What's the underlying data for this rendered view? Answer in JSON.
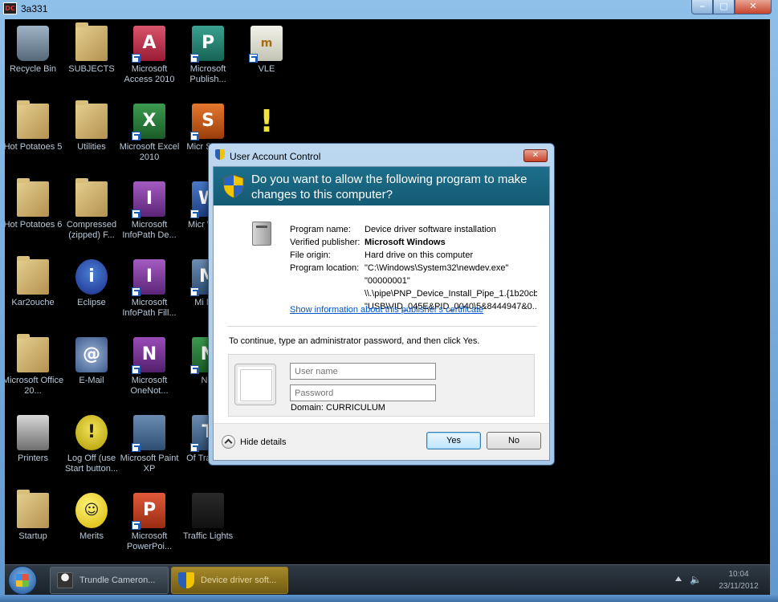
{
  "window": {
    "title": "3a331",
    "app_badge": "DC",
    "controls": [
      "–",
      "▢",
      "✕"
    ]
  },
  "desktop_icons": [
    {
      "label": "Recycle Bin",
      "glyph": "bin"
    },
    {
      "label": "SUBJECTS",
      "glyph": "folder"
    },
    {
      "label": "Microsoft Access 2010",
      "glyph": "A"
    },
    {
      "label": "Microsoft Publish...",
      "glyph": "P"
    },
    {
      "label": "VLE",
      "glyph": "m"
    },
    {
      "label": "Hot Potatoes 5",
      "glyph": "folder"
    },
    {
      "label": "Utilities",
      "glyph": "folder"
    },
    {
      "label": "Microsoft Excel 2010",
      "glyph": "X"
    },
    {
      "label": "Micr Share",
      "glyph": "S"
    },
    {
      "label": "Hot Potatoes 6",
      "glyph": "folder"
    },
    {
      "label": "Compressed (zipped) F...",
      "glyph": "folder"
    },
    {
      "label": "Microsoft InfoPath De...",
      "glyph": "I"
    },
    {
      "label": "Micr Word",
      "glyph": "W"
    },
    {
      "label": "Kar2ouche",
      "glyph": "folder"
    },
    {
      "label": "Eclipse",
      "glyph": "i"
    },
    {
      "label": "Microsoft InfoPath Fill...",
      "glyph": "I"
    },
    {
      "label": "Mi Mar",
      "glyph": "M"
    },
    {
      "label": "Microsoft Office 20...",
      "glyph": "folder"
    },
    {
      "label": "E-Mail",
      "glyph": "@"
    },
    {
      "label": "Microsoft OneNot...",
      "glyph": "N"
    },
    {
      "label": "Not",
      "glyph": "N"
    },
    {
      "label": "Printers",
      "glyph": "printer"
    },
    {
      "label": "Log Off (use Start button...",
      "glyph": "!"
    },
    {
      "label": "Microsoft Paint XP",
      "glyph": "paint"
    },
    {
      "label": "Of Training",
      "glyph": "T"
    },
    {
      "label": "Startup",
      "glyph": "folder"
    },
    {
      "label": "Merits",
      "glyph": "smile"
    },
    {
      "label": "Microsoft PowerPoi...",
      "glyph": "P"
    },
    {
      "label": "Traffic Lights",
      "glyph": "traffic"
    }
  ],
  "uac": {
    "title": "User Account Control",
    "close": "✕",
    "question": "Do you want to allow the following program to make changes to this computer?",
    "fields": {
      "program_name_label": "Program name:",
      "program_name": "Device driver software installation",
      "publisher_label": "Verified publisher:",
      "publisher": "Microsoft Windows",
      "origin_label": "File origin:",
      "origin": "Hard drive on this computer",
      "location_label": "Program location:",
      "location_lines": [
        "\"C:\\Windows\\System32\\newdev.exe\"",
        "\"00000001\"",
        "\\\\.\\pipe\\PNP_Device_Install_Pipe_1.{1b20cb(",
        "\"USB\\VID_045E&PID_0040\\5&8444947&0..."
      ]
    },
    "cert_link": "Show information about this publisher's certificate",
    "instruction": "To continue, type an administrator password, and then click Yes.",
    "username_placeholder": "User name",
    "password_placeholder": "Password",
    "domain": "Domain: CURRICULUM",
    "hide_details": "Hide details",
    "yes": "Yes",
    "no": "No"
  },
  "taskbar": {
    "items": [
      "Trundle Cameron...",
      "Device driver soft..."
    ],
    "time": "10:04",
    "date": "23/11/2012"
  }
}
